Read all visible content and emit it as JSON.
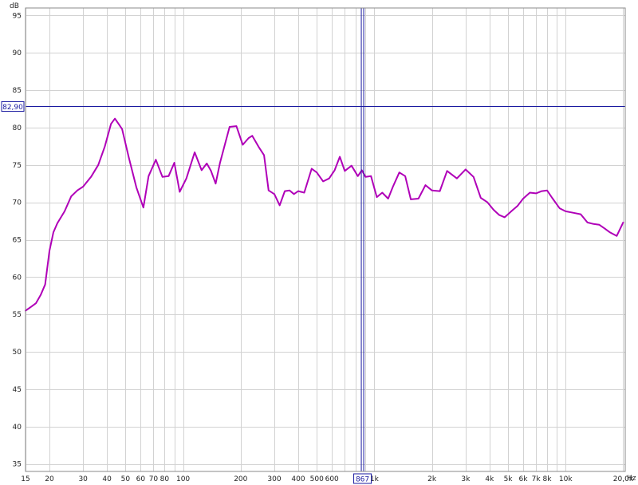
{
  "chart_data": {
    "type": "line",
    "x_scale": "log",
    "xlim": [
      15,
      20500
    ],
    "ylim": [
      34,
      96
    ],
    "grid": true,
    "ylabel": "dB",
    "xunit": "Hz",
    "x_tick_labels": [
      {
        "v": 15,
        "t": "15"
      },
      {
        "v": 20,
        "t": "20"
      },
      {
        "v": 30,
        "t": "30"
      },
      {
        "v": 40,
        "t": "40"
      },
      {
        "v": 50,
        "t": "50"
      },
      {
        "v": 60,
        "t": "60"
      },
      {
        "v": 70,
        "t": "70"
      },
      {
        "v": 80,
        "t": "80"
      },
      {
        "v": 100,
        "t": "100"
      },
      {
        "v": 200,
        "t": "200"
      },
      {
        "v": 300,
        "t": "300"
      },
      {
        "v": 400,
        "t": "400"
      },
      {
        "v": 500,
        "t": "500"
      },
      {
        "v": 600,
        "t": "600"
      },
      {
        "v": 800,
        "t": "8"
      },
      {
        "v": 1000,
        "t": "1k"
      },
      {
        "v": 2000,
        "t": "2k"
      },
      {
        "v": 3000,
        "t": "3k"
      },
      {
        "v": 4000,
        "t": "4k"
      },
      {
        "v": 5000,
        "t": "5k"
      },
      {
        "v": 6000,
        "t": "6k"
      },
      {
        "v": 7000,
        "t": "7k"
      },
      {
        "v": 8000,
        "t": "8k"
      },
      {
        "v": 10000,
        "t": "10k"
      },
      {
        "v": 20000,
        "t": "20,0k"
      }
    ],
    "x_gridlines": [
      15,
      20,
      30,
      40,
      50,
      60,
      70,
      80,
      90,
      100,
      200,
      300,
      400,
      500,
      600,
      700,
      800,
      900,
      1000,
      2000,
      3000,
      4000,
      5000,
      6000,
      7000,
      8000,
      9000,
      10000,
      20000
    ],
    "y_ticks": [
      35,
      40,
      45,
      50,
      55,
      60,
      65,
      70,
      75,
      80,
      85,
      90,
      95
    ],
    "cursor": {
      "x": 867,
      "x_label": "867",
      "y": 82.9,
      "y_label": "82,90",
      "color": "#1a1aa0"
    },
    "series": [
      {
        "color": "#b000b8",
        "x": [
          15,
          16,
          17,
          18,
          19,
          20,
          21,
          22,
          24,
          26,
          28,
          30,
          33,
          36,
          39,
          42,
          44,
          46,
          48,
          52,
          57,
          62,
          66,
          72,
          78,
          84,
          90,
          96,
          104,
          115,
          125,
          133,
          140,
          148,
          156,
          175,
          190,
          205,
          220,
          230,
          250,
          265,
          280,
          300,
          320,
          340,
          360,
          380,
          400,
          430,
          470,
          500,
          540,
          580,
          620,
          660,
          700,
          760,
          820,
          860,
          900,
          960,
          1030,
          1100,
          1180,
          1250,
          1350,
          1450,
          1550,
          1700,
          1850,
          2000,
          2200,
          2400,
          2700,
          3000,
          3300,
          3600,
          3900,
          4200,
          4500,
          4800,
          5200,
          5600,
          6000,
          6500,
          7000,
          7500,
          8000,
          8500,
          9300,
          10000,
          11000,
          12000,
          13000,
          14000,
          15000,
          16000,
          17000,
          18500,
          20000
        ],
        "y": [
          55.5,
          56,
          56.5,
          57.6,
          59,
          63.5,
          66,
          67.2,
          68.8,
          70.8,
          71.6,
          72.1,
          73.4,
          75,
          77.5,
          80.5,
          81.2,
          80.5,
          79.8,
          76,
          72,
          69.3,
          73.5,
          75.7,
          73.4,
          73.5,
          75.3,
          71.4,
          73.2,
          76.7,
          74.3,
          75.2,
          74.2,
          72.5,
          75.3,
          80.1,
          80.2,
          77.7,
          78.6,
          78.9,
          77.3,
          76.3,
          71.6,
          71.1,
          69.6,
          71.5,
          71.6,
          71.1,
          71.5,
          71.3,
          74.5,
          74,
          72.8,
          73.2,
          74.3,
          76.1,
          74.2,
          74.9,
          73.5,
          74.3,
          73.4,
          73.5,
          70.7,
          71.3,
          70.5,
          72.1,
          74,
          73.5,
          70.4,
          70.5,
          72.3,
          71.6,
          71.5,
          74.2,
          73.2,
          74.4,
          73.4,
          70.6,
          70,
          69,
          68.3,
          68,
          68.8,
          69.5,
          70.5,
          71.3,
          71.2,
          71.5,
          71.6,
          70.6,
          69.2,
          68.8,
          68.6,
          68.4,
          67.3,
          67.1,
          67,
          66.5,
          66,
          65.5,
          67.3
        ]
      }
    ]
  }
}
